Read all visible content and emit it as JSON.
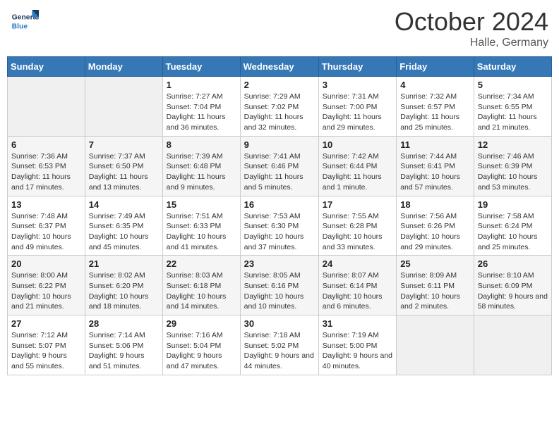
{
  "header": {
    "logo_general": "General",
    "logo_blue": "Blue",
    "month": "October 2024",
    "location": "Halle, Germany"
  },
  "days_of_week": [
    "Sunday",
    "Monday",
    "Tuesday",
    "Wednesday",
    "Thursday",
    "Friday",
    "Saturday"
  ],
  "weeks": [
    [
      {
        "day": "",
        "empty": true
      },
      {
        "day": "",
        "empty": true
      },
      {
        "day": "1",
        "sunrise": "Sunrise: 7:27 AM",
        "sunset": "Sunset: 7:04 PM",
        "daylight": "Daylight: 11 hours and 36 minutes."
      },
      {
        "day": "2",
        "sunrise": "Sunrise: 7:29 AM",
        "sunset": "Sunset: 7:02 PM",
        "daylight": "Daylight: 11 hours and 32 minutes."
      },
      {
        "day": "3",
        "sunrise": "Sunrise: 7:31 AM",
        "sunset": "Sunset: 7:00 PM",
        "daylight": "Daylight: 11 hours and 29 minutes."
      },
      {
        "day": "4",
        "sunrise": "Sunrise: 7:32 AM",
        "sunset": "Sunset: 6:57 PM",
        "daylight": "Daylight: 11 hours and 25 minutes."
      },
      {
        "day": "5",
        "sunrise": "Sunrise: 7:34 AM",
        "sunset": "Sunset: 6:55 PM",
        "daylight": "Daylight: 11 hours and 21 minutes."
      }
    ],
    [
      {
        "day": "6",
        "sunrise": "Sunrise: 7:36 AM",
        "sunset": "Sunset: 6:53 PM",
        "daylight": "Daylight: 11 hours and 17 minutes."
      },
      {
        "day": "7",
        "sunrise": "Sunrise: 7:37 AM",
        "sunset": "Sunset: 6:50 PM",
        "daylight": "Daylight: 11 hours and 13 minutes."
      },
      {
        "day": "8",
        "sunrise": "Sunrise: 7:39 AM",
        "sunset": "Sunset: 6:48 PM",
        "daylight": "Daylight: 11 hours and 9 minutes."
      },
      {
        "day": "9",
        "sunrise": "Sunrise: 7:41 AM",
        "sunset": "Sunset: 6:46 PM",
        "daylight": "Daylight: 11 hours and 5 minutes."
      },
      {
        "day": "10",
        "sunrise": "Sunrise: 7:42 AM",
        "sunset": "Sunset: 6:44 PM",
        "daylight": "Daylight: 11 hours and 1 minute."
      },
      {
        "day": "11",
        "sunrise": "Sunrise: 7:44 AM",
        "sunset": "Sunset: 6:41 PM",
        "daylight": "Daylight: 10 hours and 57 minutes."
      },
      {
        "day": "12",
        "sunrise": "Sunrise: 7:46 AM",
        "sunset": "Sunset: 6:39 PM",
        "daylight": "Daylight: 10 hours and 53 minutes."
      }
    ],
    [
      {
        "day": "13",
        "sunrise": "Sunrise: 7:48 AM",
        "sunset": "Sunset: 6:37 PM",
        "daylight": "Daylight: 10 hours and 49 minutes."
      },
      {
        "day": "14",
        "sunrise": "Sunrise: 7:49 AM",
        "sunset": "Sunset: 6:35 PM",
        "daylight": "Daylight: 10 hours and 45 minutes."
      },
      {
        "day": "15",
        "sunrise": "Sunrise: 7:51 AM",
        "sunset": "Sunset: 6:33 PM",
        "daylight": "Daylight: 10 hours and 41 minutes."
      },
      {
        "day": "16",
        "sunrise": "Sunrise: 7:53 AM",
        "sunset": "Sunset: 6:30 PM",
        "daylight": "Daylight: 10 hours and 37 minutes."
      },
      {
        "day": "17",
        "sunrise": "Sunrise: 7:55 AM",
        "sunset": "Sunset: 6:28 PM",
        "daylight": "Daylight: 10 hours and 33 minutes."
      },
      {
        "day": "18",
        "sunrise": "Sunrise: 7:56 AM",
        "sunset": "Sunset: 6:26 PM",
        "daylight": "Daylight: 10 hours and 29 minutes."
      },
      {
        "day": "19",
        "sunrise": "Sunrise: 7:58 AM",
        "sunset": "Sunset: 6:24 PM",
        "daylight": "Daylight: 10 hours and 25 minutes."
      }
    ],
    [
      {
        "day": "20",
        "sunrise": "Sunrise: 8:00 AM",
        "sunset": "Sunset: 6:22 PM",
        "daylight": "Daylight: 10 hours and 21 minutes."
      },
      {
        "day": "21",
        "sunrise": "Sunrise: 8:02 AM",
        "sunset": "Sunset: 6:20 PM",
        "daylight": "Daylight: 10 hours and 18 minutes."
      },
      {
        "day": "22",
        "sunrise": "Sunrise: 8:03 AM",
        "sunset": "Sunset: 6:18 PM",
        "daylight": "Daylight: 10 hours and 14 minutes."
      },
      {
        "day": "23",
        "sunrise": "Sunrise: 8:05 AM",
        "sunset": "Sunset: 6:16 PM",
        "daylight": "Daylight: 10 hours and 10 minutes."
      },
      {
        "day": "24",
        "sunrise": "Sunrise: 8:07 AM",
        "sunset": "Sunset: 6:14 PM",
        "daylight": "Daylight: 10 hours and 6 minutes."
      },
      {
        "day": "25",
        "sunrise": "Sunrise: 8:09 AM",
        "sunset": "Sunset: 6:11 PM",
        "daylight": "Daylight: 10 hours and 2 minutes."
      },
      {
        "day": "26",
        "sunrise": "Sunrise: 8:10 AM",
        "sunset": "Sunset: 6:09 PM",
        "daylight": "Daylight: 9 hours and 58 minutes."
      }
    ],
    [
      {
        "day": "27",
        "sunrise": "Sunrise: 7:12 AM",
        "sunset": "Sunset: 5:07 PM",
        "daylight": "Daylight: 9 hours and 55 minutes."
      },
      {
        "day": "28",
        "sunrise": "Sunrise: 7:14 AM",
        "sunset": "Sunset: 5:06 PM",
        "daylight": "Daylight: 9 hours and 51 minutes."
      },
      {
        "day": "29",
        "sunrise": "Sunrise: 7:16 AM",
        "sunset": "Sunset: 5:04 PM",
        "daylight": "Daylight: 9 hours and 47 minutes."
      },
      {
        "day": "30",
        "sunrise": "Sunrise: 7:18 AM",
        "sunset": "Sunset: 5:02 PM",
        "daylight": "Daylight: 9 hours and 44 minutes."
      },
      {
        "day": "31",
        "sunrise": "Sunrise: 7:19 AM",
        "sunset": "Sunset: 5:00 PM",
        "daylight": "Daylight: 9 hours and 40 minutes."
      },
      {
        "day": "",
        "empty": true
      },
      {
        "day": "",
        "empty": true
      }
    ]
  ]
}
